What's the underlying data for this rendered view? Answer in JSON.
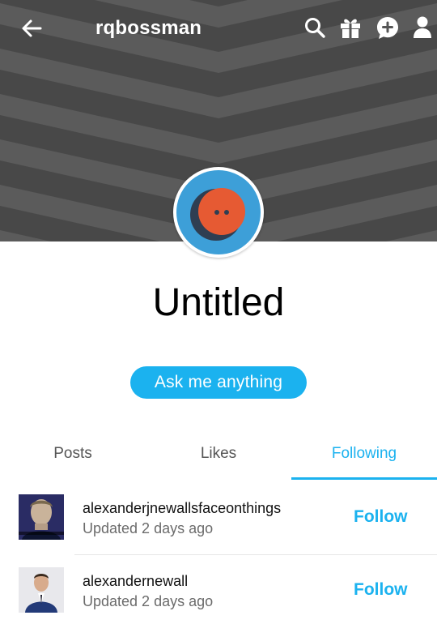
{
  "header": {
    "blog_name": "rqbossman",
    "back_icon": "arrow-left-icon",
    "icons": [
      "search-icon",
      "gift-icon",
      "compose-message-icon",
      "account-icon"
    ],
    "stripe_colors": [
      "#5b5b5b",
      "#484848"
    ]
  },
  "profile": {
    "avatar_icon": "orange-face-avatar",
    "avatar_colors": {
      "ring": "#3d9fd8",
      "face": "#e65a33",
      "shadow": "#2f3e52"
    },
    "title": "Untitled",
    "ask_label": "Ask me anything"
  },
  "tabs": [
    {
      "label": "Posts",
      "active": false
    },
    {
      "label": "Likes",
      "active": false
    },
    {
      "label": "Following",
      "active": true
    }
  ],
  "following": [
    {
      "name": "alexanderjnewallsfaceonthings",
      "updated": "Updated 2 days ago",
      "action": "Follow"
    },
    {
      "name": "alexandernewall",
      "updated": "Updated 2 days ago",
      "action": "Follow"
    }
  ],
  "accent_color": "#1bb2ef"
}
